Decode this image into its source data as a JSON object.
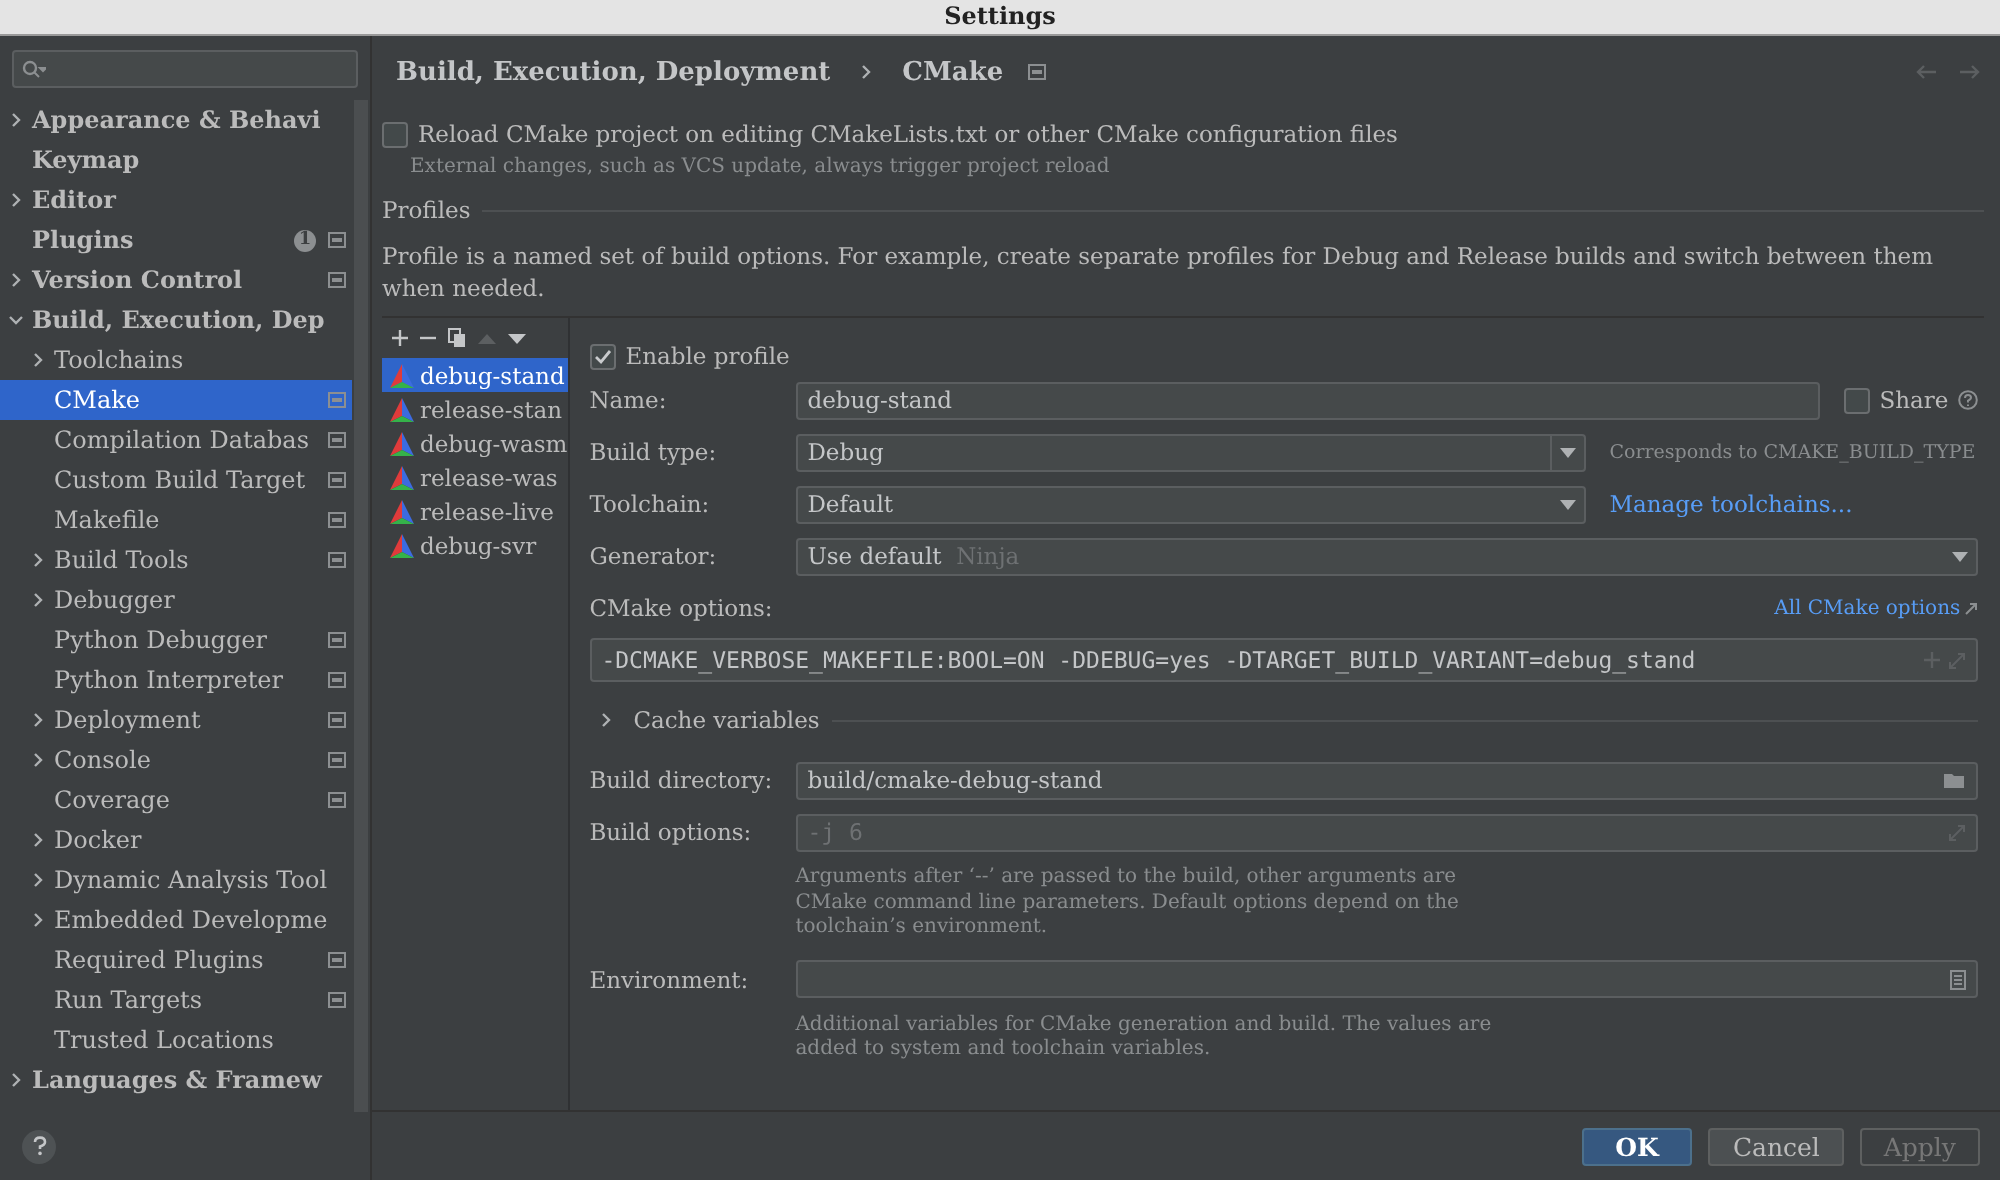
{
  "window": {
    "title": "Settings"
  },
  "sidebar": {
    "items": [
      {
        "label": "Appearance & Behavi",
        "expanded": false,
        "selected": false,
        "project_icon": false
      },
      {
        "label": "Keymap",
        "selected": false,
        "project_icon": false
      },
      {
        "label": "Editor",
        "expanded": false,
        "selected": false,
        "project_icon": false
      },
      {
        "label": "Plugins",
        "selected": false,
        "project_icon": true,
        "badge": "1"
      },
      {
        "label": "Version Control",
        "expanded": false,
        "selected": false,
        "project_icon": true
      },
      {
        "label": "Build, Execution, Dep",
        "expanded": true,
        "selected": false,
        "project_icon": false,
        "children": [
          {
            "label": "Toolchains",
            "expanded": false,
            "selected": false,
            "project_icon": false
          },
          {
            "label": "CMake",
            "selected": true,
            "project_icon": true
          },
          {
            "label": "Compilation Databas",
            "selected": false,
            "project_icon": true
          },
          {
            "label": "Custom Build Target",
            "selected": false,
            "project_icon": true
          },
          {
            "label": "Makefile",
            "selected": false,
            "project_icon": true
          },
          {
            "label": "Build Tools",
            "expanded": false,
            "selected": false,
            "project_icon": true
          },
          {
            "label": "Debugger",
            "expanded": false,
            "selected": false,
            "project_icon": false
          },
          {
            "label": "Python Debugger",
            "selected": false,
            "project_icon": true
          },
          {
            "label": "Python Interpreter",
            "selected": false,
            "project_icon": true
          },
          {
            "label": "Deployment",
            "expanded": false,
            "selected": false,
            "project_icon": true
          },
          {
            "label": "Console",
            "expanded": false,
            "selected": false,
            "project_icon": true
          },
          {
            "label": "Coverage",
            "selected": false,
            "project_icon": true
          },
          {
            "label": "Docker",
            "expanded": false,
            "selected": false,
            "project_icon": false
          },
          {
            "label": "Dynamic Analysis Tool",
            "expanded": false,
            "selected": false,
            "project_icon": false
          },
          {
            "label": "Embedded Developme",
            "expanded": false,
            "selected": false,
            "project_icon": false
          },
          {
            "label": "Required Plugins",
            "selected": false,
            "project_icon": true
          },
          {
            "label": "Run Targets",
            "selected": false,
            "project_icon": true
          },
          {
            "label": "Trusted Locations",
            "selected": false,
            "project_icon": false
          }
        ]
      },
      {
        "label": "Languages & Framew",
        "expanded": false,
        "selected": false,
        "project_icon": false
      }
    ]
  },
  "breadcrumb": [
    "Build, Execution, Deployment",
    "CMake"
  ],
  "reload_option": {
    "label": "Reload CMake project on editing CMakeLists.txt or other CMake configuration files",
    "checked": false,
    "hint": "External changes, such as VCS update, always trigger project reload"
  },
  "profiles_section": {
    "title": "Profiles",
    "description": "Profile is a named set of build options. For example, create separate profiles for Debug and Release builds and switch between them when needed."
  },
  "profiles": [
    {
      "name": "debug-stand",
      "selected": true
    },
    {
      "name": "release-stan",
      "selected": false
    },
    {
      "name": "debug-wasm",
      "selected": false
    },
    {
      "name": "release-was",
      "selected": false
    },
    {
      "name": "release-live",
      "selected": false
    },
    {
      "name": "debug-svr",
      "selected": false
    }
  ],
  "profile_form": {
    "enable_profile": {
      "label": "Enable profile",
      "checked": true
    },
    "name": {
      "label": "Name:",
      "value": "debug-stand"
    },
    "share": {
      "label": "Share",
      "checked": false
    },
    "build_type": {
      "label": "Build type:",
      "value": "Debug",
      "hint": "Corresponds to CMAKE_BUILD_TYPE"
    },
    "toolchain": {
      "label": "Toolchain:",
      "value": "Default",
      "link": "Manage toolchains..."
    },
    "generator": {
      "label": "Generator:",
      "value": "Use default",
      "hint": "Ninja"
    },
    "cmake_options": {
      "label": "CMake options:",
      "link": "All CMake options",
      "value": "-DCMAKE_VERBOSE_MAKEFILE:BOOL=ON -DDEBUG=yes -DTARGET_BUILD_VARIANT=debug_stand"
    },
    "cache_variables": {
      "label": "Cache variables",
      "expanded": false
    },
    "build_directory": {
      "label": "Build directory:",
      "value": "build/cmake-debug-stand"
    },
    "build_options": {
      "label": "Build options:",
      "placeholder": "-j 6",
      "hint": "Arguments after ‘--’ are passed to the build, other arguments are CMake command line parameters. Default options depend on the toolchain’s environment."
    },
    "environment": {
      "label": "Environment:",
      "hint": "Additional variables for CMake generation and build. The values are added to system and toolchain variables."
    }
  },
  "buttons": [
    {
      "label": "OK",
      "kind": "default",
      "disabled": false
    },
    {
      "label": "Cancel",
      "kind": "normal",
      "disabled": false
    },
    {
      "label": "Apply",
      "kind": "normal",
      "disabled": true
    }
  ]
}
